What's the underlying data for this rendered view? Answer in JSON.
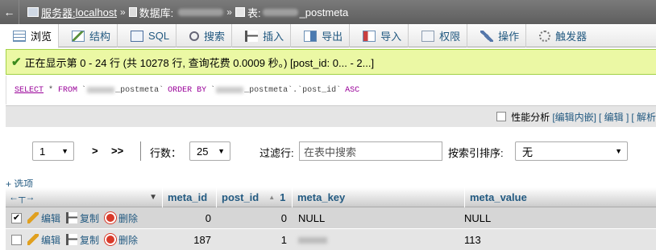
{
  "breadcrumb": {
    "back_label": "←",
    "server_prefix": "服务器:",
    "server": "localhost",
    "sep": "»",
    "db_prefix": "数据库:",
    "table_prefix": "表:",
    "table_suffix": "_postmeta"
  },
  "tabs": [
    {
      "label": "浏览",
      "icon": "browse-icon",
      "active": true
    },
    {
      "label": "结构",
      "icon": "structure-icon",
      "active": false
    },
    {
      "label": "SQL",
      "icon": "sql-icon",
      "active": false
    },
    {
      "label": "搜索",
      "icon": "search-icon",
      "active": false
    },
    {
      "label": "插入",
      "icon": "insert-icon",
      "active": false
    },
    {
      "label": "导出",
      "icon": "export-icon",
      "active": false
    },
    {
      "label": "导入",
      "icon": "import-icon",
      "active": false
    },
    {
      "label": "权限",
      "icon": "privileges-icon",
      "active": false
    },
    {
      "label": "操作",
      "icon": "operations-icon",
      "active": false
    },
    {
      "label": "触发器",
      "icon": "triggers-icon",
      "active": false
    }
  ],
  "success_message": "正在显示第 0 - 24 行 (共 10278 行, 查询花费 0.0009 秒。) [post_id: 0... - 2...]",
  "sql": {
    "select": "SELECT",
    "star": " * ",
    "from": "FROM",
    "tbl1": "_postmeta`",
    "order": "ORDER BY",
    "tbl2": "_postmeta`.`post_id`",
    "asc": "ASC"
  },
  "options_bar": {
    "profiling_label": "性能分析",
    "inline_edit": "[编辑内嵌]",
    "edit": "[ 编辑 ]",
    "explain": "[ 解析"
  },
  "nav": {
    "page_value": "1",
    "next": ">",
    "last": ">>",
    "rows_label": "行数：",
    "rows_value": "25",
    "filter_label": "过滤行:",
    "filter_placeholder": "在表中搜索",
    "sort_label": "按索引排序:",
    "sort_value": "无"
  },
  "options_link": "+ 选项",
  "table": {
    "columns": [
      "meta_id",
      "post_id",
      "meta_key",
      "meta_value"
    ],
    "sort_indicator": "▲",
    "sort_number": "1",
    "actions": {
      "edit": "编辑",
      "copy": "复制",
      "delete": "删除"
    },
    "rows": [
      {
        "checked": true,
        "meta_id": "0",
        "post_id": "0",
        "meta_key": "NULL",
        "meta_value": "NULL"
      },
      {
        "checked": false,
        "meta_id": "187",
        "post_id": "1",
        "meta_key": "",
        "meta_value": "113"
      }
    ]
  },
  "colors": {
    "link": "#235a81",
    "success_bg": "#ebf8a4",
    "success_border": "#a2d246"
  }
}
